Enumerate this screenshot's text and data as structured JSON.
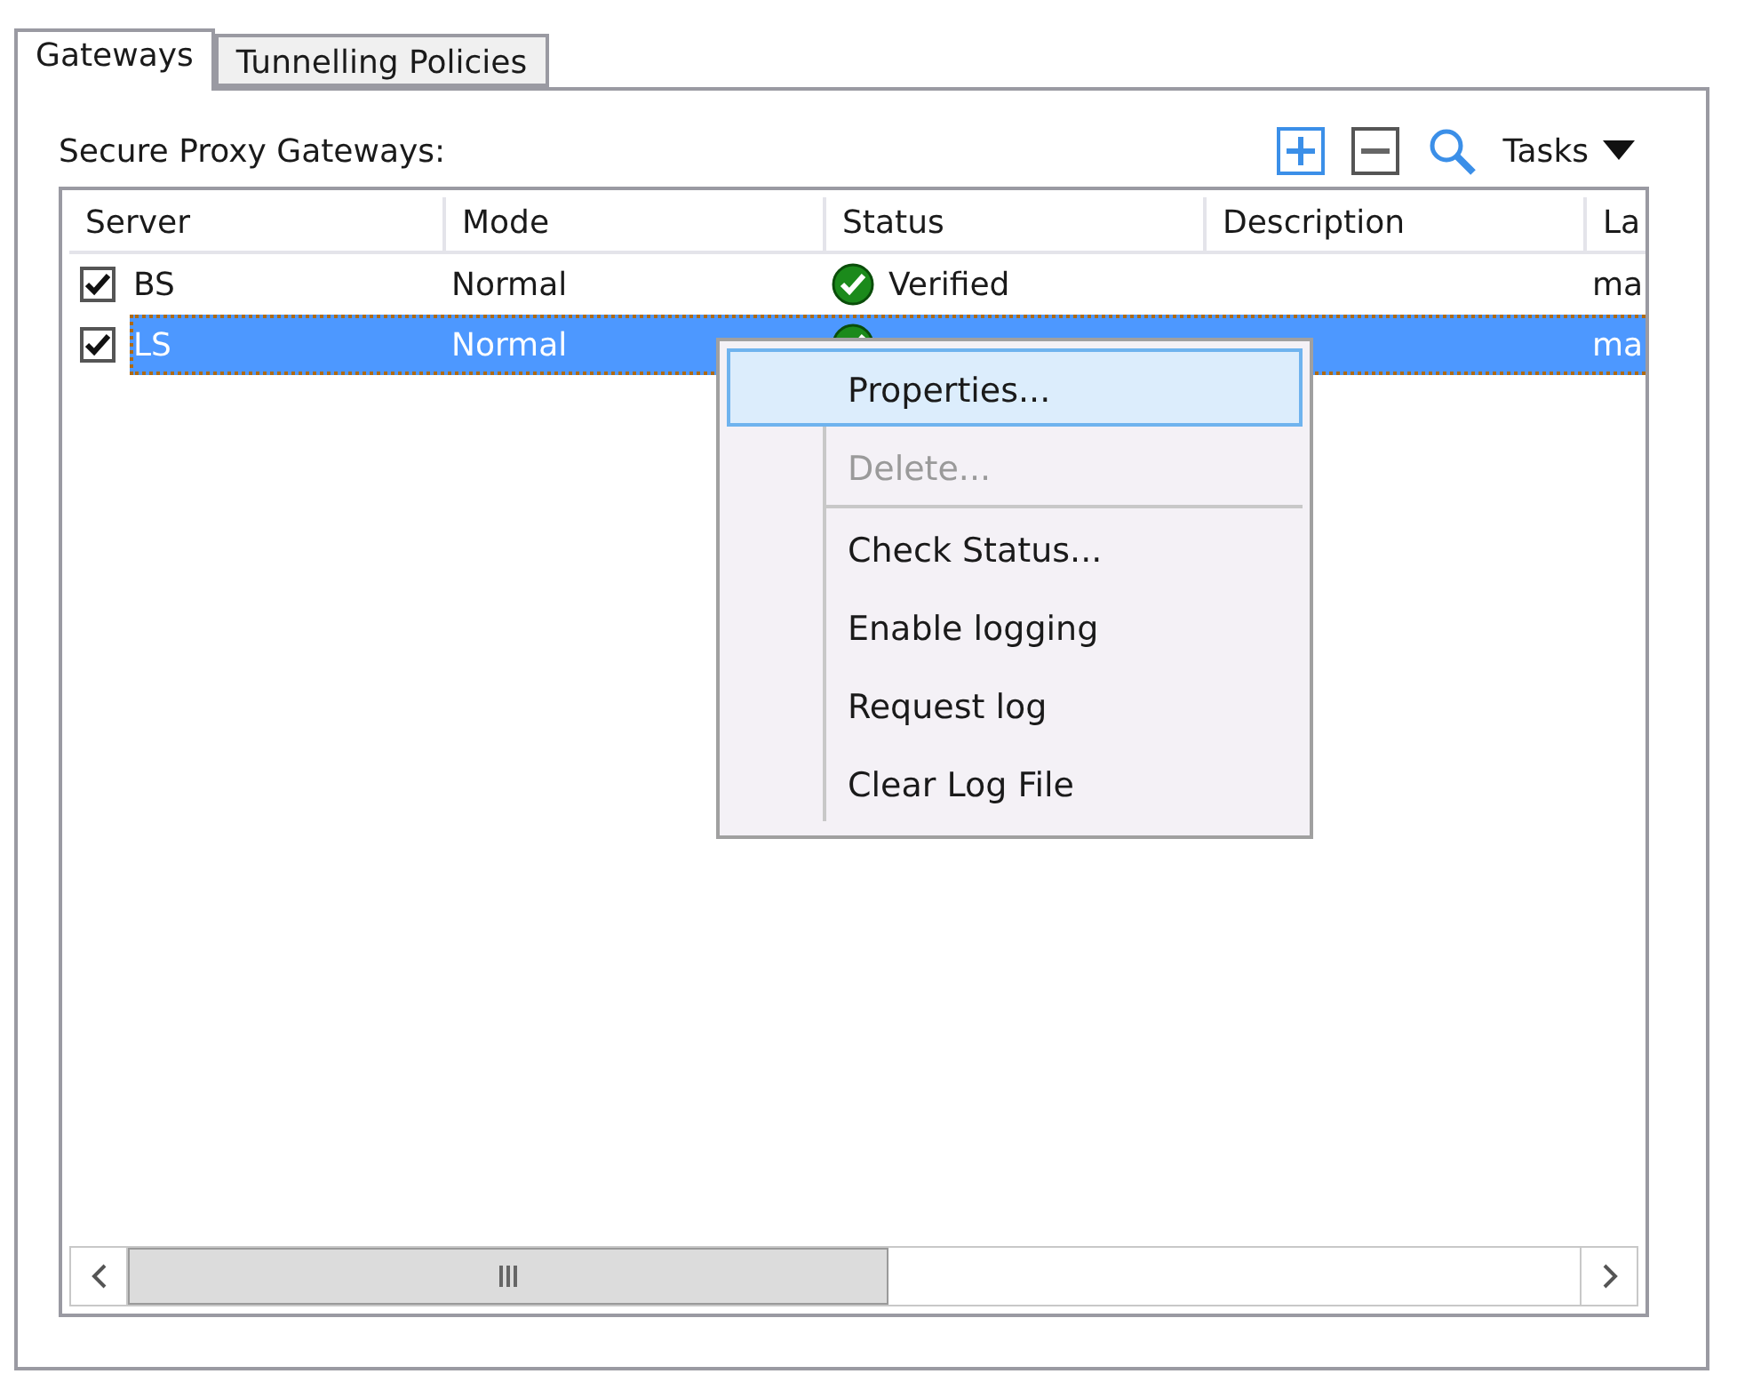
{
  "tabs": [
    {
      "label": "Gateways",
      "selected": true
    },
    {
      "label": "Tunnelling Policies",
      "selected": false
    }
  ],
  "section_label": "Secure Proxy Gateways:",
  "toolbar": {
    "tasks_label": "Tasks"
  },
  "table": {
    "columns": [
      "Server",
      "Mode",
      "Status",
      "Description",
      "La"
    ],
    "rows": [
      {
        "checked": true,
        "selected": false,
        "server": "BS",
        "mode": "Normal",
        "status": "Verified",
        "column_5": "ma"
      },
      {
        "checked": true,
        "selected": true,
        "server": "LS",
        "mode": "Normal",
        "column_5": "ma"
      }
    ]
  },
  "context_menu": [
    {
      "label": "Properties...",
      "disabled": false,
      "selected": true
    },
    {
      "label": "Delete...",
      "disabled": true,
      "selected": false,
      "separator_after": true
    },
    {
      "label": "Check Status...",
      "disabled": false,
      "selected": false
    },
    {
      "label": "Enable logging",
      "disabled": false,
      "selected": false
    },
    {
      "label": "Request log",
      "disabled": false,
      "selected": false
    },
    {
      "label": "Clear Log File",
      "disabled": false,
      "selected": false
    }
  ]
}
